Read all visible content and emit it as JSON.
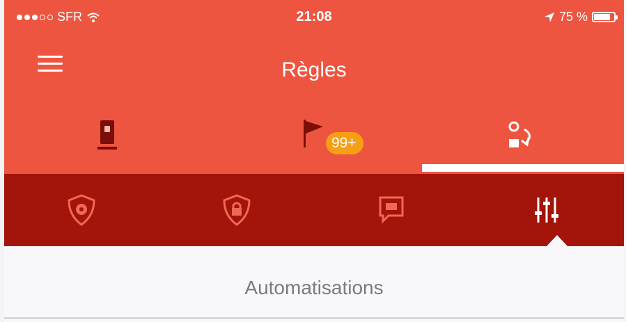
{
  "status_bar": {
    "carrier": "SFR",
    "time": "21:08",
    "battery_percent": "75 %",
    "battery_level": 0.75
  },
  "nav": {
    "title": "Règles"
  },
  "top_tabs": [
    {
      "icon": "mobile-device-icon",
      "selected": false
    },
    {
      "icon": "flag-icon",
      "selected": false,
      "badge": "99+"
    },
    {
      "icon": "automation-swap-icon",
      "selected": true
    }
  ],
  "sub_tabs": [
    {
      "icon": "shield-mail-icon",
      "selected": false
    },
    {
      "icon": "shield-lock-icon",
      "selected": false
    },
    {
      "icon": "message-icon",
      "selected": false
    },
    {
      "icon": "sliders-icon",
      "selected": true
    }
  ],
  "content": {
    "section_title": "Automatisations"
  },
  "colors": {
    "header": "#ee5540",
    "subnav": "#a3140a",
    "badge": "#f5a014",
    "background": "#f8f8fa"
  }
}
